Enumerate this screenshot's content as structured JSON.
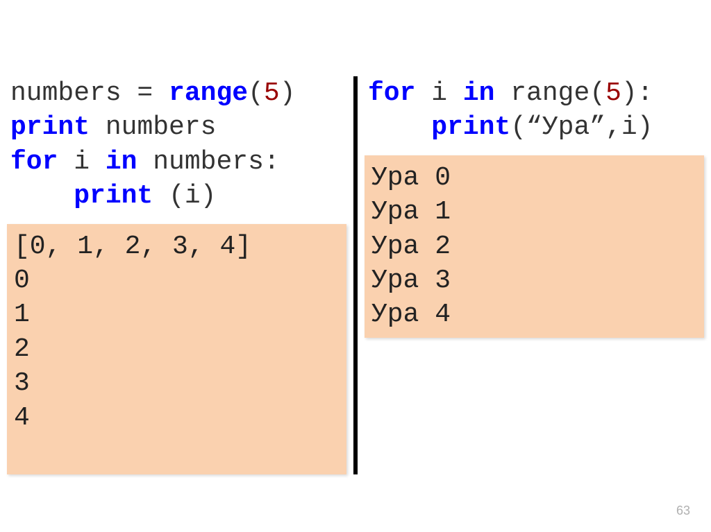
{
  "left": {
    "code": {
      "line1_pre": "numbers = ",
      "line1_kw": "range",
      "line1_post_open": "(",
      "line1_num": "5",
      "line1_post_close": ")",
      "line2_kw": "print",
      "line2_rest": " numbers",
      "line3_for": "for",
      "line3_mid": " i ",
      "line3_in": "in",
      "line3_rest": " numbers:",
      "line4_pad": "    ",
      "line4_kw": "print",
      "line4_rest": " (i)"
    },
    "output": "[0, 1, 2, 3, 4]\n0\n1\n2\n3\n4\n "
  },
  "right": {
    "code": {
      "line1_for": "for",
      "line1_mid": " i ",
      "line1_in": "in",
      "line1_rest_pre": " range(",
      "line1_num": "5",
      "line1_rest_post": "):",
      "line2_pad": "    ",
      "line2_kw": "print",
      "line2_rest": "(“Ура”,i)"
    },
    "output": "Ура 0\nУра 1\nУра 2\nУра 3\nУра 4"
  },
  "page_number": "63"
}
